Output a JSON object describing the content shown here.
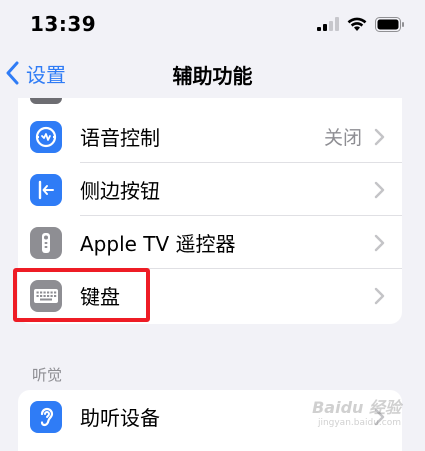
{
  "status_bar": {
    "time": "13:39"
  },
  "nav": {
    "back_label": "设置",
    "title": "辅助功能"
  },
  "settings_rows": [
    {
      "label": "语音控制",
      "value": "关闭",
      "icon": "voice-control-icon"
    },
    {
      "label": "侧边按钮",
      "value": "",
      "icon": "side-button-icon"
    },
    {
      "label": "Apple TV 遥控器",
      "value": "",
      "icon": "apple-tv-remote-icon"
    },
    {
      "label": "键盘",
      "value": "",
      "icon": "keyboard-icon"
    }
  ],
  "hearing_section": {
    "header": "听觉",
    "rows": [
      {
        "label": "助听设备",
        "value": "",
        "icon": "hearing-aid-icon"
      }
    ]
  },
  "watermark": {
    "brand": "Baidu 经验",
    "url": "jingyan.baidu.com"
  },
  "colors": {
    "accent": "#2f7cf6",
    "background": "#f2f2f7",
    "highlight": "#ee1c25",
    "icon_blue": "#2f7cf6",
    "icon_gray": "#8e8e93"
  }
}
